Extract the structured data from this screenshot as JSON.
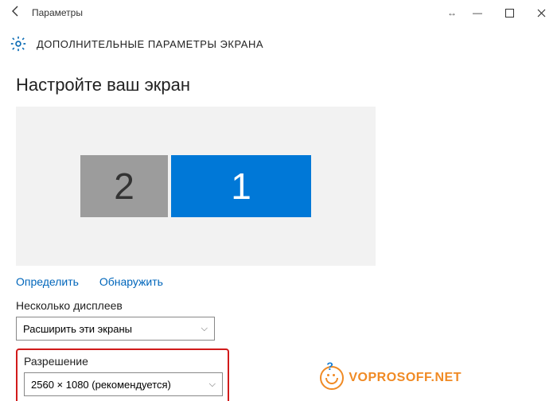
{
  "window": {
    "title": "Параметры"
  },
  "header": {
    "title": "ДОПОЛНИТЕЛЬНЫЕ ПАРАМЕТРЫ ЭКРАНА"
  },
  "page": {
    "heading": "Настройте ваш экран"
  },
  "monitors": {
    "left_label": "2",
    "right_label": "1"
  },
  "links": {
    "identify": "Определить",
    "detect": "Обнаружить"
  },
  "multi_display": {
    "label": "Несколько дисплеев",
    "value": "Расширить эти экраны"
  },
  "resolution": {
    "label": "Разрешение",
    "value": "2560 × 1080 (рекомендуется)"
  },
  "watermark": "VOPROSOFF.NET"
}
